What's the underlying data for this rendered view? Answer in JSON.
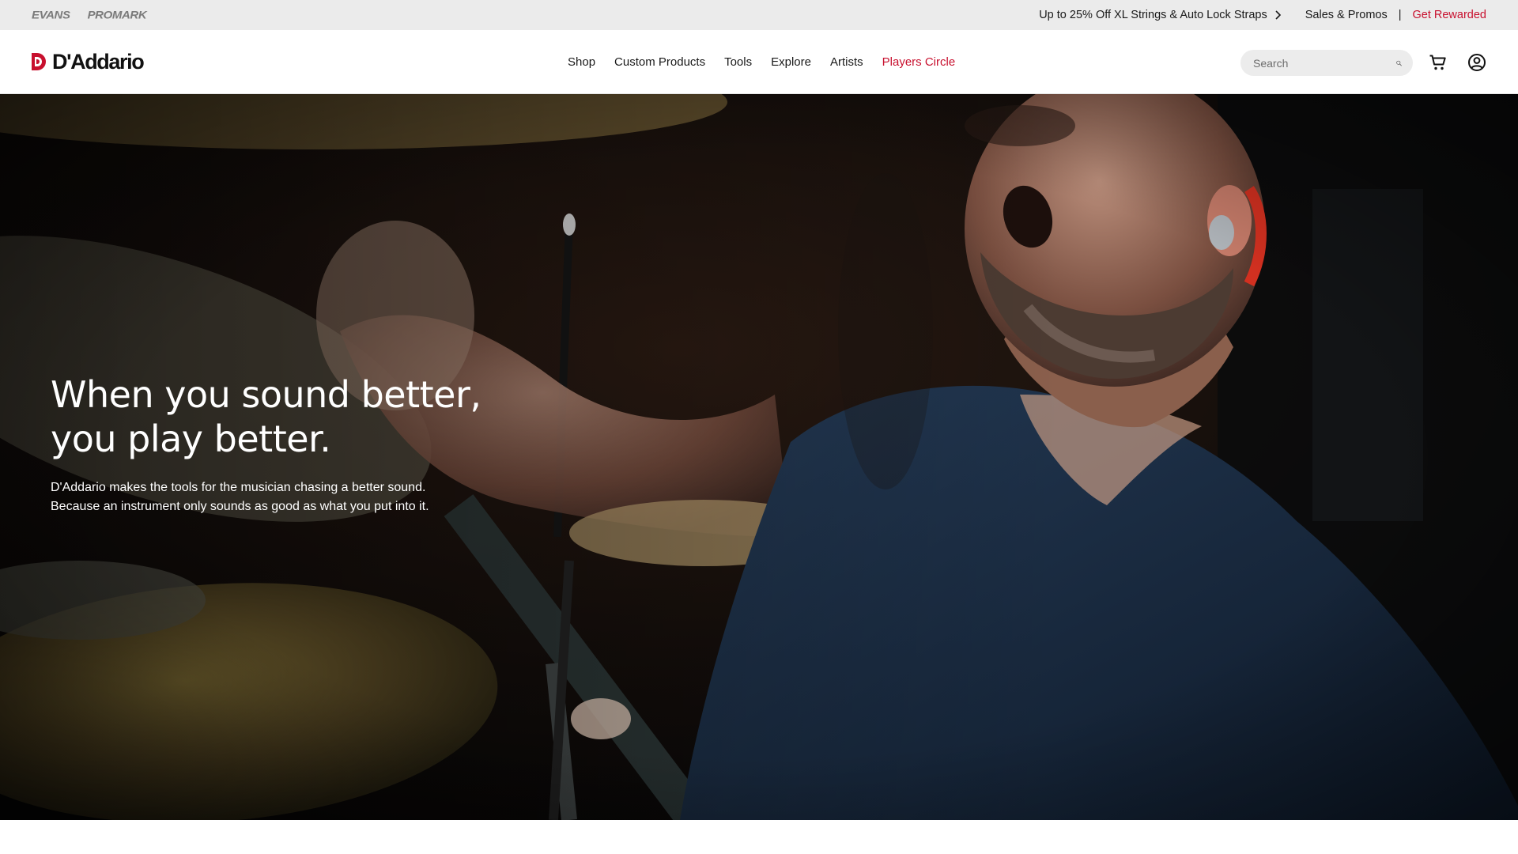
{
  "utility_bar": {
    "brands": [
      "EVANS",
      "PROMARK"
    ],
    "promo_text": "Up to 25% Off XL Strings & Auto Lock Straps",
    "sales_label": "Sales & Promos",
    "separator": "|",
    "rewards_label": "Get Rewarded",
    "rewards_color": "#c8102e",
    "background": "#ebebeb"
  },
  "header": {
    "logo_text": "D'Addario",
    "logo_color": "#c8102e",
    "nav": [
      {
        "label": "Shop"
      },
      {
        "label": "Custom Products"
      },
      {
        "label": "Tools"
      },
      {
        "label": "Explore"
      },
      {
        "label": "Artists"
      },
      {
        "label": "Players Circle",
        "highlight": true
      }
    ],
    "search": {
      "placeholder": "Search",
      "value": "",
      "icon": "search-icon"
    },
    "cart_icon": "cart-icon",
    "account_icon": "account-icon"
  },
  "hero": {
    "headline_lines": [
      "When you sound better,",
      "you play better."
    ],
    "subcopy_lines": [
      "D'Addario makes the tools for the musician chasing a better sound.",
      "Because an instrument only sounds as good as what you put into it."
    ],
    "image_description_icon": "drummer-video-still"
  }
}
